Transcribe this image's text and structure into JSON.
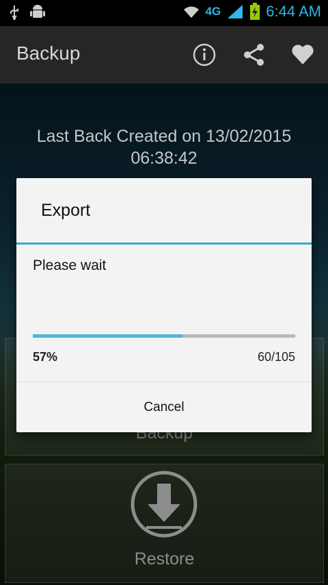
{
  "status_bar": {
    "network": "4G",
    "time": "6:44 AM",
    "icons": [
      "usb-icon",
      "android-debug-icon",
      "wifi-icon",
      "signal-icon",
      "battery-charging-icon"
    ]
  },
  "action_bar": {
    "title": "Backup",
    "icons": [
      "info-icon",
      "share-icon",
      "heart-icon"
    ]
  },
  "main": {
    "last_backup_line1": "Last Back Created on 13/02/2015",
    "last_backup_line2": "06:38:42",
    "tiles": [
      {
        "label": "Backup"
      },
      {
        "label": "Restore",
        "icon": "download-icon"
      }
    ]
  },
  "dialog": {
    "title": "Export",
    "message": "Please wait",
    "progress": {
      "fraction": 0.57,
      "percent_label": "57%",
      "count_label": "60/105"
    },
    "cancel_label": "Cancel"
  },
  "colors": {
    "accent": "#33b5e5",
    "dialog_divider": "#33a9cf",
    "progress_fill": "#4fb6d5",
    "action_bar": "#262626"
  }
}
